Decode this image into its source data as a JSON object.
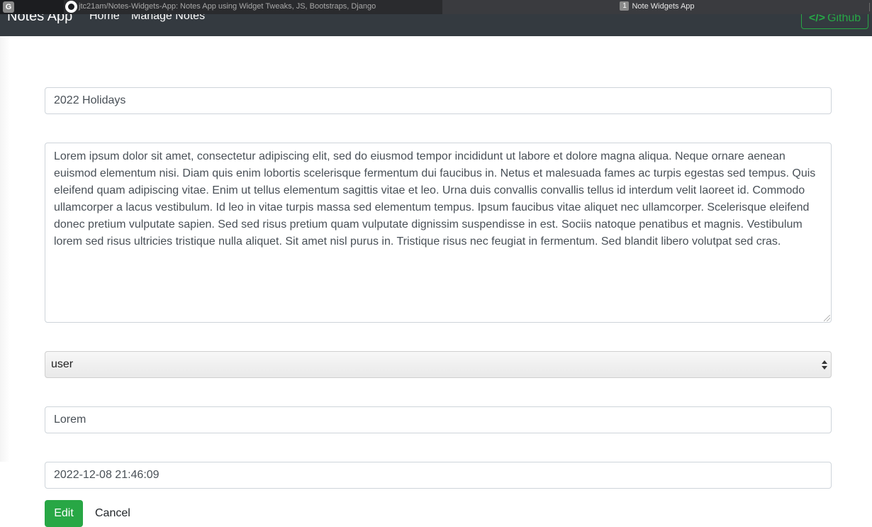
{
  "browser": {
    "profile_badge": "G",
    "tabs": [
      {
        "label": "jtc21am/Notes-Widgets-App: Notes App using Widget Tweaks, JS, Bootstraps, Django",
        "active": false
      },
      {
        "number": "1",
        "label": "Note Widgets App",
        "active": true
      }
    ]
  },
  "navbar": {
    "brand": "Notes App",
    "links": [
      "Home",
      "Manage Notes"
    ],
    "github_label": "Github",
    "github_icon": "</>"
  },
  "form": {
    "title": "2022 Holidays",
    "body": "Lorem ipsum dolor sit amet, consectetur adipiscing elit, sed do eiusmod tempor incididunt ut labore et dolore magna aliqua. Neque ornare aenean euismod elementum nisi. Diam quis enim lobortis scelerisque fermentum dui faucibus in. Netus et malesuada fames ac turpis egestas sed tempus. Quis eleifend quam adipiscing vitae. Enim ut tellus elementum sagittis vitae et leo. Urna duis convallis convallis tellus id interdum velit laoreet id. Commodo ullamcorper a lacus vestibulum. Id leo in vitae turpis massa sed elementum tempus. Ipsum faucibus vitae aliquet nec ullamcorper. Scelerisque eleifend donec pretium vulputate sapien. Sed sed risus pretium quam vulputate dignissim suspendisse in est. Sociis natoque penatibus et magnis. Vestibulum lorem sed risus ultricies tristique nulla aliquet. Sit amet nisl purus in. Tristique risus nec feugiat in fermentum. Sed blandit libero volutpat sed cras.",
    "user_selected": "user",
    "tag": "Lorem",
    "datetime": "2022-12-08 21:46:09"
  },
  "actions": {
    "edit_label": "Edit",
    "cancel_label": "Cancel"
  },
  "colors": {
    "navbar_bg": "#343a40",
    "accent_green": "#28a745"
  }
}
